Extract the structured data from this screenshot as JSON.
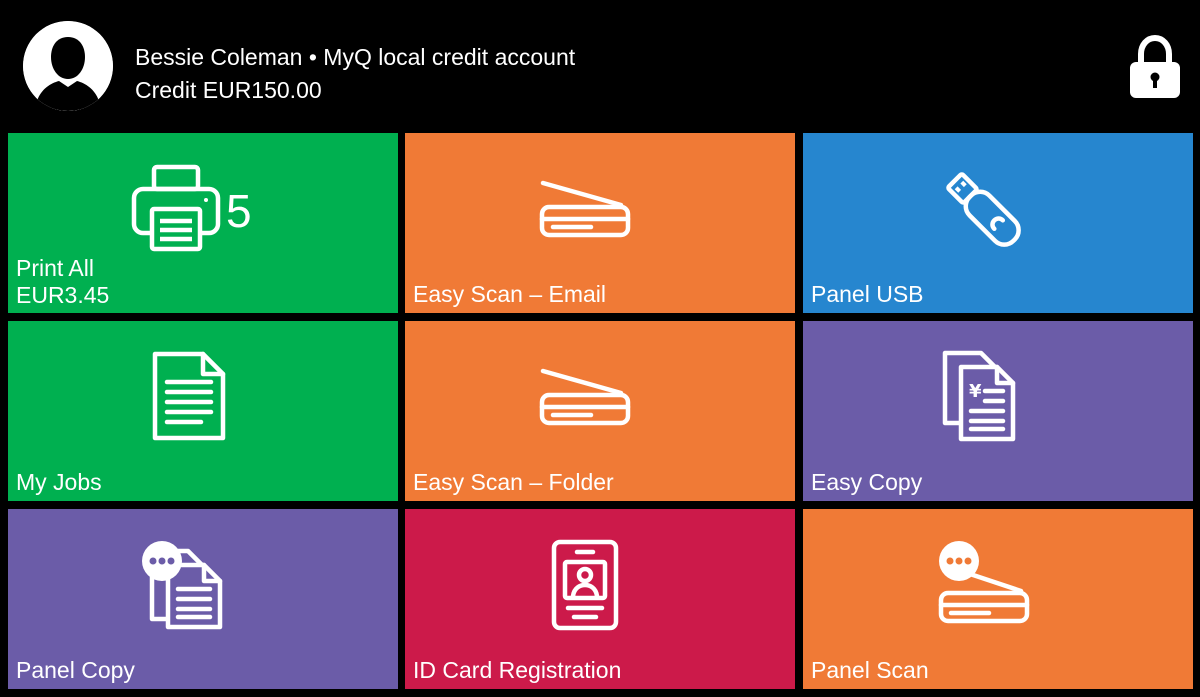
{
  "header": {
    "user_line": "Bessie Coleman • MyQ local credit account",
    "credit_line": "Credit EUR150.00"
  },
  "colors": {
    "green": "#00b050",
    "orange": "#f07a36",
    "blue": "#2686cf",
    "purple": "#6b5ca8",
    "crimson": "#cc1a4a"
  },
  "tiles": {
    "print_all": {
      "label": "Print All",
      "price": "EUR3.45",
      "count": "5",
      "icon": "printer-icon"
    },
    "easy_scan_email": {
      "label": "Easy Scan – Email",
      "icon": "scanner-icon"
    },
    "panel_usb": {
      "label": "Panel USB",
      "icon": "usb-drive-icon"
    },
    "my_jobs": {
      "label": "My Jobs",
      "icon": "document-icon"
    },
    "easy_scan_folder": {
      "label": "Easy Scan – Folder",
      "icon": "scanner-icon"
    },
    "easy_copy": {
      "label": "Easy Copy",
      "icon": "copy-documents-icon"
    },
    "panel_copy": {
      "label": "Panel Copy",
      "icon": "copy-more-icon"
    },
    "id_card_registration": {
      "label": "ID Card Registration",
      "icon": "id-card-icon"
    },
    "panel_scan": {
      "label": "Panel Scan",
      "icon": "scanner-more-icon"
    }
  }
}
